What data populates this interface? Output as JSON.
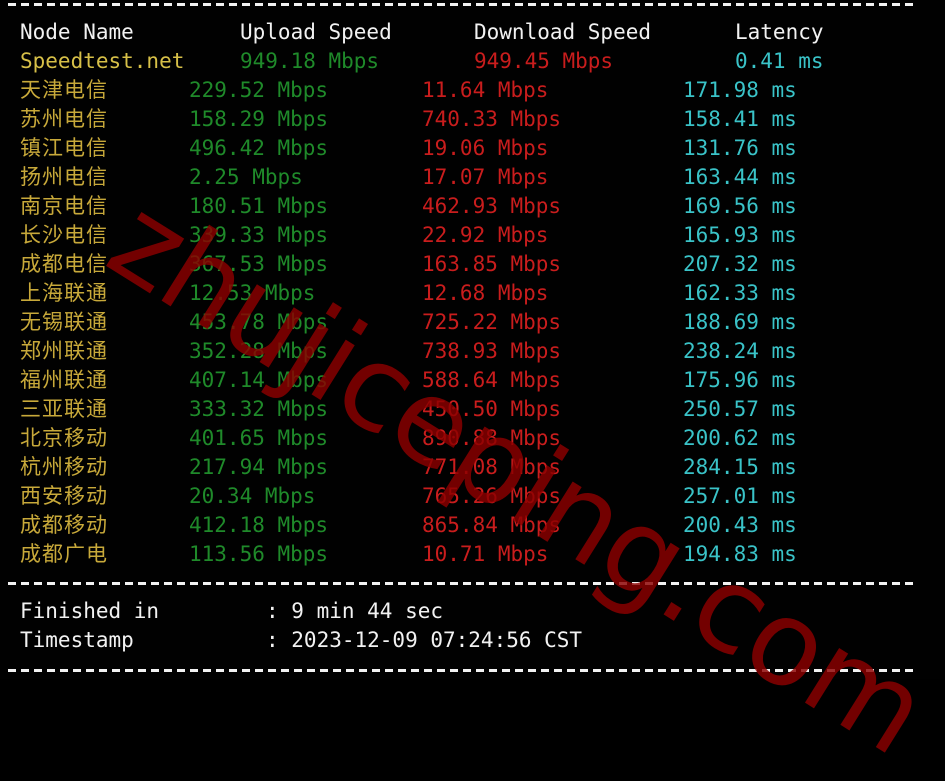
{
  "header": {
    "node_name": "Node Name",
    "upload_speed": "Upload Speed",
    "download_speed": "Download Speed",
    "latency": "Latency"
  },
  "rows": [
    {
      "node": "Speedtest.net",
      "upload": "949.18 Mbps",
      "download": "949.45 Mbps",
      "latency": "0.41 ms"
    },
    {
      "node": "天津电信",
      "upload": "229.52 Mbps",
      "download": "11.64 Mbps",
      "latency": "171.98 ms"
    },
    {
      "node": "苏州电信",
      "upload": "158.29 Mbps",
      "download": "740.33 Mbps",
      "latency": "158.41 ms"
    },
    {
      "node": "镇江电信",
      "upload": "496.42 Mbps",
      "download": "19.06 Mbps",
      "latency": "131.76 ms"
    },
    {
      "node": "扬州电信",
      "upload": "2.25 Mbps",
      "download": "17.07 Mbps",
      "latency": "163.44 ms"
    },
    {
      "node": "南京电信",
      "upload": "180.51 Mbps",
      "download": "462.93 Mbps",
      "latency": "169.56 ms"
    },
    {
      "node": "长沙电信",
      "upload": "339.33 Mbps",
      "download": "22.92 Mbps",
      "latency": "165.93 ms"
    },
    {
      "node": "成都电信",
      "upload": "367.53 Mbps",
      "download": "163.85 Mbps",
      "latency": "207.32 ms"
    },
    {
      "node": "上海联通",
      "upload": "12.53 Mbps",
      "download": "12.68 Mbps",
      "latency": "162.33 ms"
    },
    {
      "node": "无锡联通",
      "upload": "453.78 Mbps",
      "download": "725.22 Mbps",
      "latency": "188.69 ms"
    },
    {
      "node": "郑州联通",
      "upload": "352.28 Mbps",
      "download": "738.93 Mbps",
      "latency": "238.24 ms"
    },
    {
      "node": "福州联通",
      "upload": "407.14 Mbps",
      "download": "588.64 Mbps",
      "latency": "175.96 ms"
    },
    {
      "node": "三亚联通",
      "upload": "333.32 Mbps",
      "download": "450.50 Mbps",
      "latency": "250.57 ms"
    },
    {
      "node": "北京移动",
      "upload": "401.65 Mbps",
      "download": "890.88 Mbps",
      "latency": "200.62 ms"
    },
    {
      "node": "杭州移动",
      "upload": "217.94 Mbps",
      "download": "771.08 Mbps",
      "latency": "284.15 ms"
    },
    {
      "node": "西安移动",
      "upload": "20.34 Mbps",
      "download": "765.26 Mbps",
      "latency": "257.01 ms"
    },
    {
      "node": "成都移动",
      "upload": "412.18 Mbps",
      "download": "865.84 Mbps",
      "latency": "200.43 ms"
    },
    {
      "node": "成都广电",
      "upload": "113.56 Mbps",
      "download": "10.71 Mbps",
      "latency": "194.83 ms"
    }
  ],
  "footer": {
    "finished_label": "Finished in",
    "finished_value": ": 9 min 44 sec",
    "timestamp_label": "Timestamp",
    "timestamp_value": ": 2023-12-09 07:24:56 CST"
  },
  "watermark": "zhujiceping.com",
  "colors": {
    "background": "#010101",
    "header_text": "#f2f2f2",
    "node_name": "#c8a93a",
    "upload": "#1f8a2a",
    "download": "#c91d1d",
    "latency": "#3ac3c8",
    "watermark": "#8c0000"
  }
}
